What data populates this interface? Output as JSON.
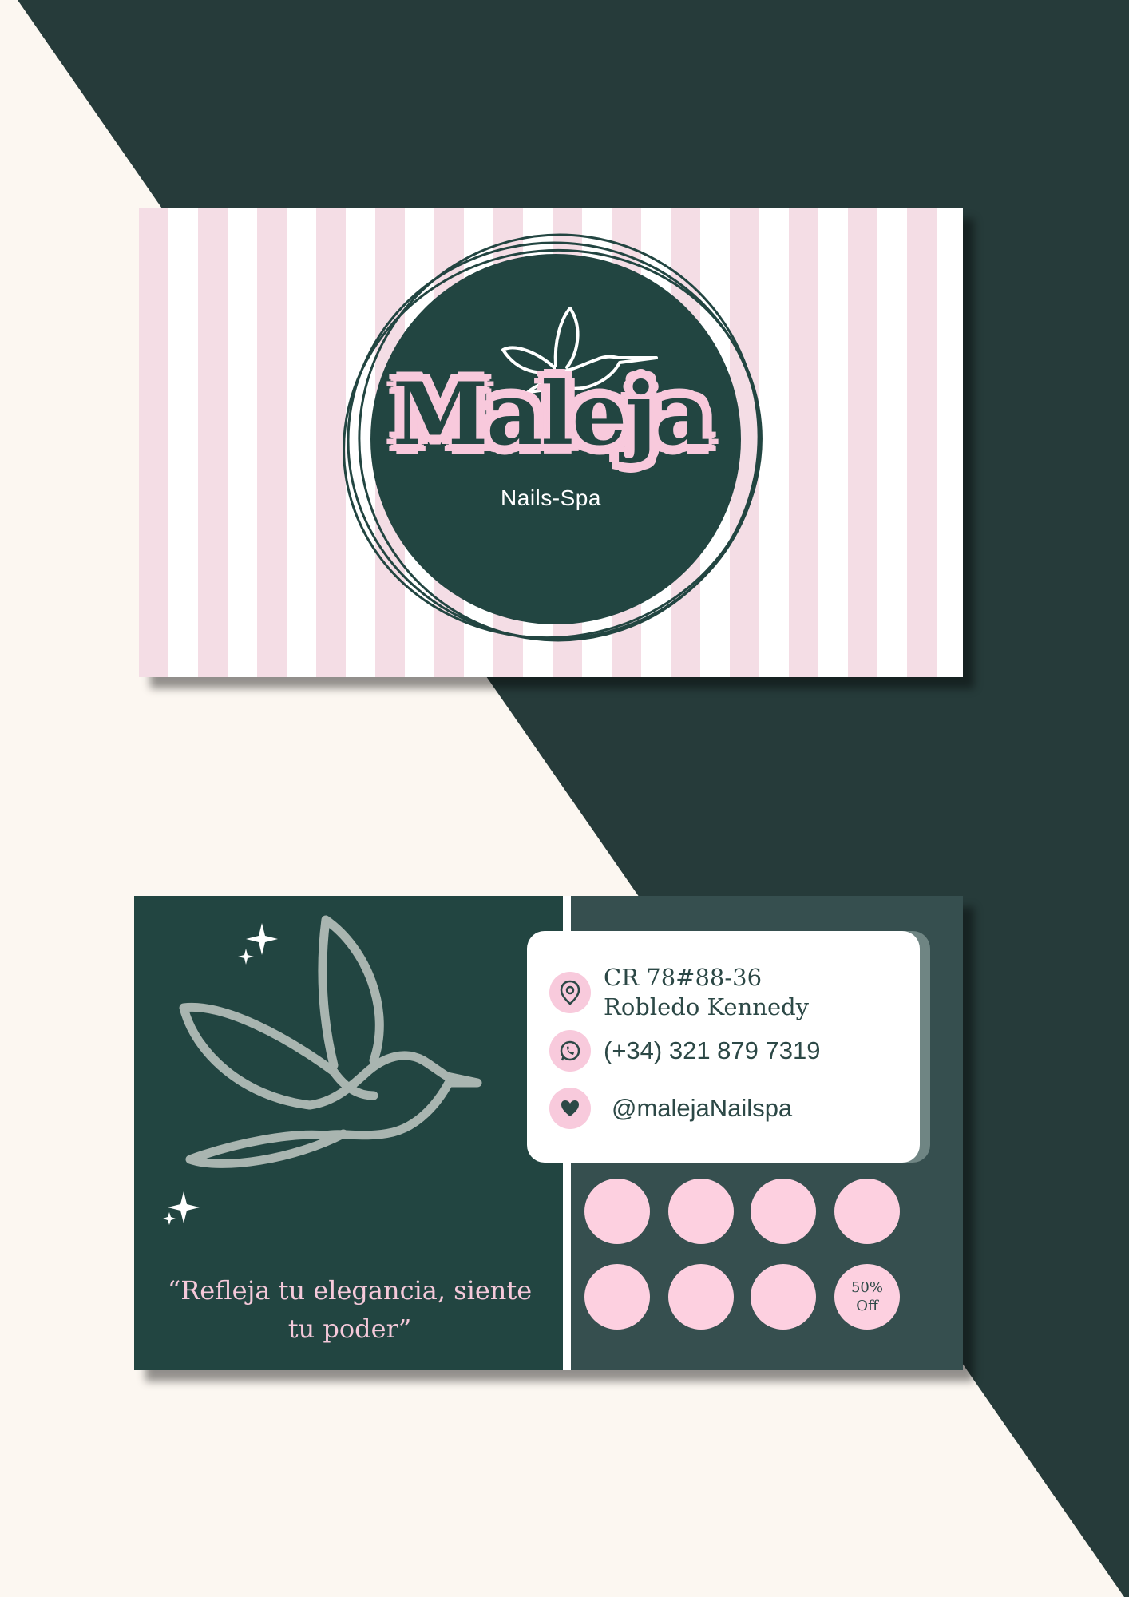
{
  "colors": {
    "background_light": "#fcf7f1",
    "background_dark": "#263b3a",
    "brand_green": "#224541",
    "brand_pink": "#f8c9dc",
    "stripe_pink": "#f4dde5"
  },
  "front": {
    "brand_name": "Maleja",
    "brand_subtitle": "Nails-Spa"
  },
  "back": {
    "quote": "“Refleja tu elegancia, siente tu poder”",
    "contact": {
      "address_line1": "CR 78#88-36",
      "address_line2": "Robledo Kennedy",
      "phone": "(+34) 321 879 7319",
      "social": "@malejaNailspa"
    },
    "icons": [
      "location-pin-icon",
      "whatsapp-icon",
      "heart-icon",
      "hummingbird-icon",
      "sparkle-icon"
    ],
    "stamps": {
      "total": 8,
      "reward_label_line1": "50%",
      "reward_label_line2": "Off"
    }
  }
}
